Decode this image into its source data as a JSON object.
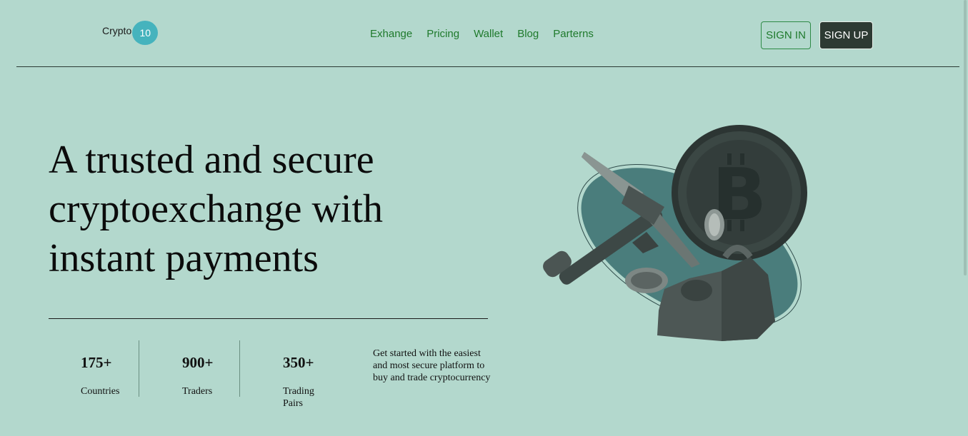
{
  "header": {
    "logo_text": "Crypto",
    "logo_badge": "10",
    "nav": [
      {
        "label": "Exhange"
      },
      {
        "label": "Pricing"
      },
      {
        "label": "Wallet"
      },
      {
        "label": "Blog"
      },
      {
        "label": "Parterns"
      }
    ],
    "signin_label": "SIGN IN",
    "signup_label": "SIGN UP"
  },
  "hero": {
    "title_line1": "A trusted and secure",
    "title_line2": "cryptoexchange with",
    "title_line3": "instant payments",
    "illustration_icon": "bitcoin-mining-pickaxe-icon"
  },
  "stats": [
    {
      "value": "175+",
      "label": "Countries"
    },
    {
      "value": "900+",
      "label": "Traders"
    },
    {
      "value": "350+",
      "label": "Trading Pairs"
    }
  ],
  "tagline": "Get started with the easiest and most secure platform to buy and trade cryptocurrency",
  "colors": {
    "background": "#b3d8cd",
    "accent_green": "#1f7a2c",
    "badge_teal": "#45b3bd",
    "dark_button": "#2d3a33"
  }
}
